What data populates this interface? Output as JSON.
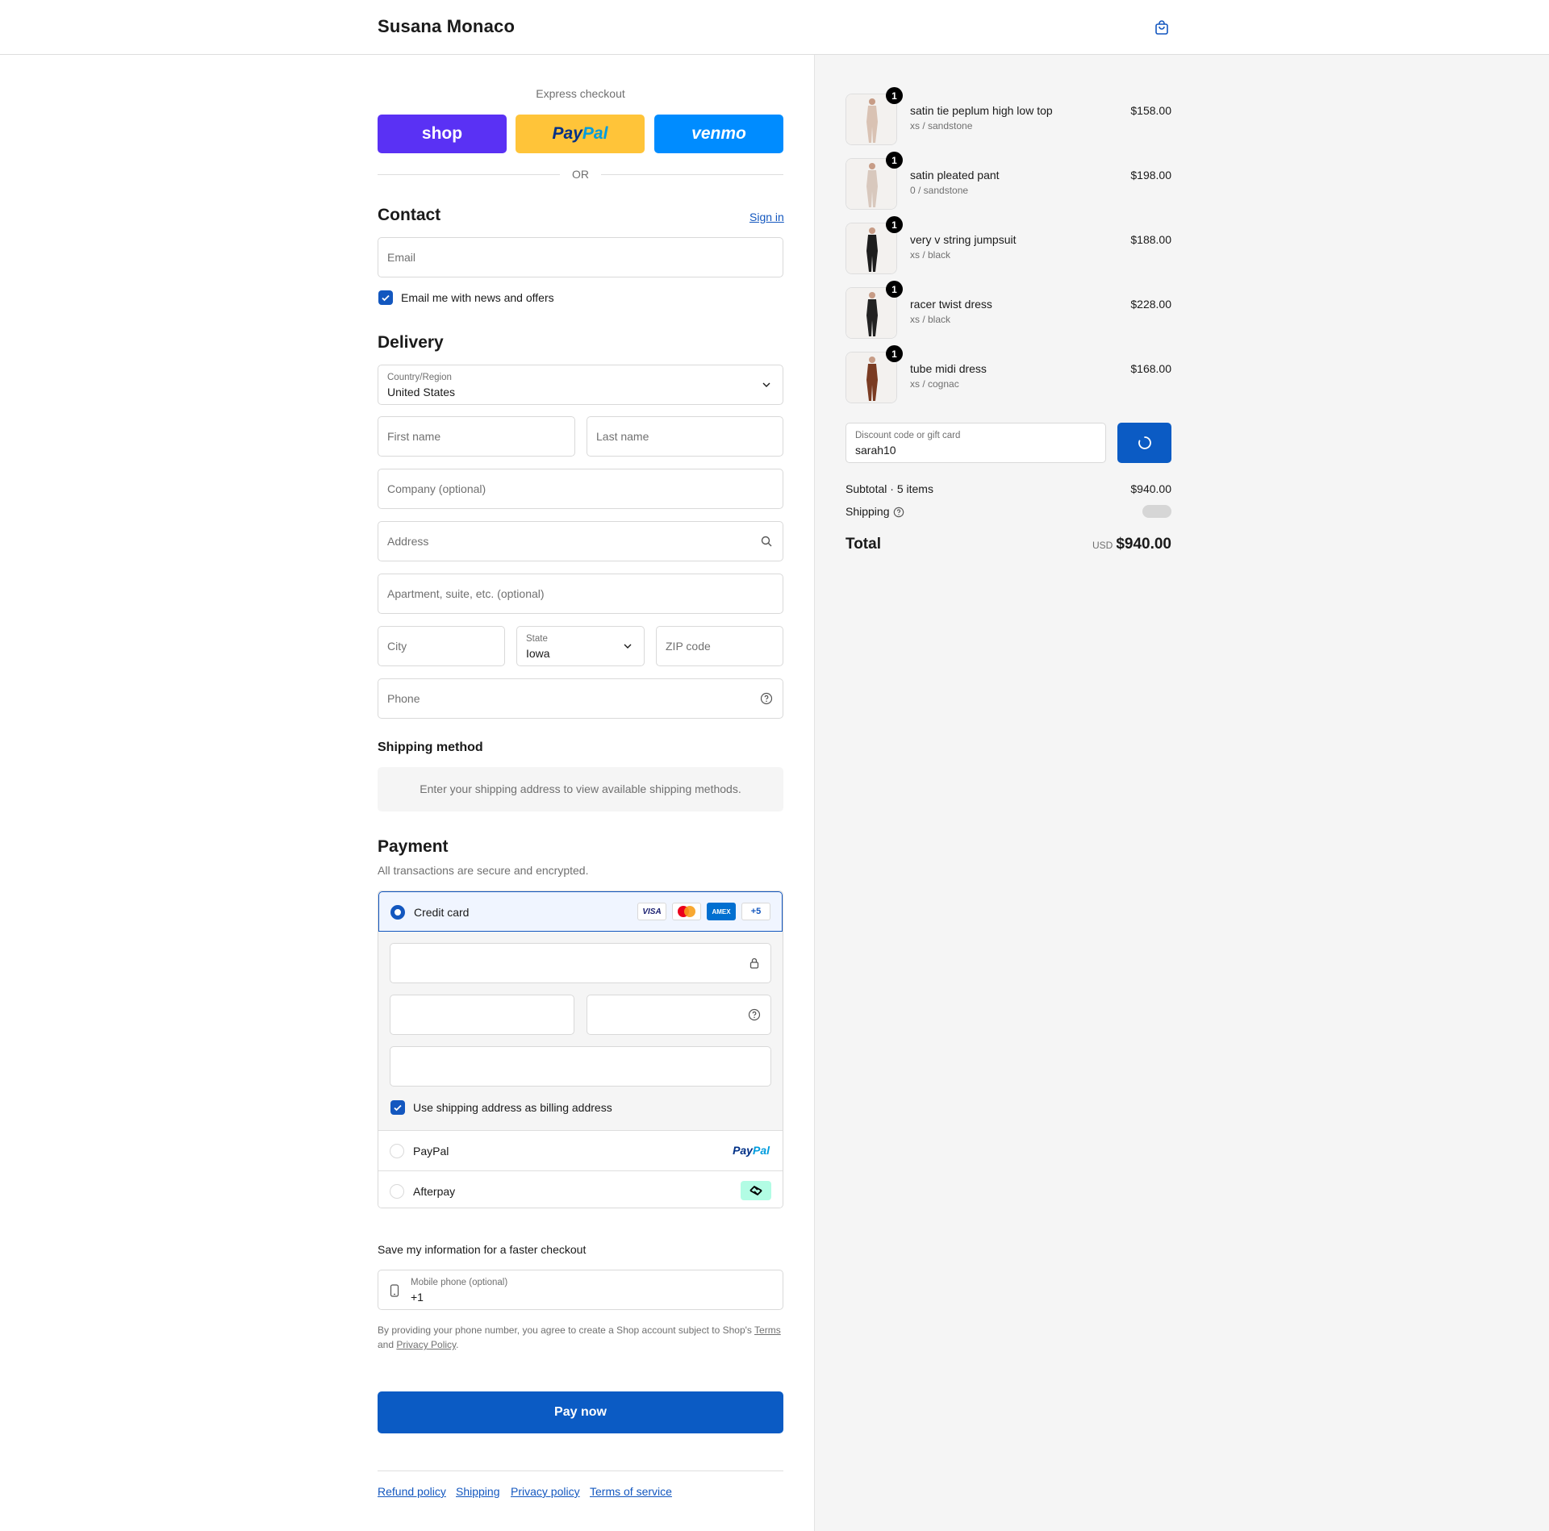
{
  "header": {
    "brand": "Susana Monaco",
    "cart_icon": "shopping-bag-icon"
  },
  "express": {
    "title": "Express checkout",
    "shop": "shop",
    "paypal_a": "Pay",
    "paypal_b": "Pal",
    "venmo": "venmo",
    "or": "OR"
  },
  "contact": {
    "title": "Contact",
    "sign_in": "Sign in",
    "email_placeholder": "Email",
    "newsletter": "Email me with news and offers"
  },
  "delivery": {
    "title": "Delivery",
    "country_label": "Country/Region",
    "country_value": "United States",
    "first_name": "First name",
    "last_name": "Last name",
    "company": "Company (optional)",
    "address": "Address",
    "apartment": "Apartment, suite, etc. (optional)",
    "city": "City",
    "state_label": "State",
    "state_value": "Iowa",
    "zip": "ZIP code",
    "phone": "Phone"
  },
  "shipping_method": {
    "title": "Shipping method",
    "message": "Enter your shipping address to view available shipping methods."
  },
  "payment": {
    "title": "Payment",
    "subtitle": "All transactions are secure and encrypted.",
    "credit_card": "Credit card",
    "cards": [
      "VISA",
      "MC",
      "AMEX",
      "+5"
    ],
    "billing_same": "Use shipping address as billing address",
    "paypal": "PayPal",
    "paypal_logo_a": "Pay",
    "paypal_logo_b": "Pal",
    "afterpay": "Afterpay"
  },
  "save_info": {
    "title": "Save my information for a faster checkout",
    "mobile_label": "Mobile phone (optional)",
    "mobile_value": "+1",
    "legal_a": "By providing your phone number, you agree to create a Shop account subject to Shop's ",
    "terms": "Terms",
    "legal_b": "and ",
    "privacy": "Privacy Policy",
    "legal_c": "."
  },
  "pay_now": "Pay now",
  "footer": {
    "links": [
      "Refund policy",
      "Shipping",
      "Privacy policy",
      "Terms of service"
    ]
  },
  "order": {
    "items": [
      {
        "qty": "1",
        "name": "satin tie peplum high low top",
        "variant": "xs / sandstone",
        "price": "$158.00",
        "color": "#d9c2b3"
      },
      {
        "qty": "1",
        "name": "satin pleated pant",
        "variant": "0 / sandstone",
        "price": "$198.00",
        "color": "#d8c8bd"
      },
      {
        "qty": "1",
        "name": "very v string jumpsuit",
        "variant": "xs / black",
        "price": "$188.00",
        "color": "#1d1d1d"
      },
      {
        "qty": "1",
        "name": "racer twist dress",
        "variant": "xs / black",
        "price": "$228.00",
        "color": "#222222"
      },
      {
        "qty": "1",
        "name": "tube midi dress",
        "variant": "xs / cognac",
        "price": "$168.00",
        "color": "#7a3b22"
      }
    ],
    "discount_label": "Discount code or gift card",
    "discount_value": "sarah10",
    "subtotal_label": "Subtotal · 5 items",
    "subtotal": "$940.00",
    "shipping_label": "Shipping",
    "total_label": "Total",
    "currency": "USD",
    "total": "$940.00"
  },
  "colors": {
    "accent": "#1357bf",
    "shop": "#5a31f4",
    "paypal": "#ffc439",
    "venmo": "#008cff",
    "afterpay": "#b2fce4"
  }
}
